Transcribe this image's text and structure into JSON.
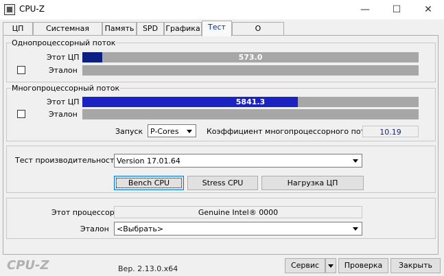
{
  "window": {
    "title": "CPU-Z",
    "minimize": "—",
    "maximize": "☐",
    "close": "✕"
  },
  "tabs": [
    {
      "label": "ЦП"
    },
    {
      "label": "Системная плата"
    },
    {
      "label": "Память"
    },
    {
      "label": "SPD"
    },
    {
      "label": "Графика"
    },
    {
      "label": "Тест"
    },
    {
      "label": "О программе"
    }
  ],
  "active_tab": "Тест",
  "single_thread": {
    "title": "Однопроцессорный поток",
    "this_cpu_label": "Этот ЦП",
    "this_cpu_value": "573.0",
    "this_cpu_fraction": 0.059,
    "reference_label": "Эталон",
    "bar_color": "#0a1f80"
  },
  "multi_thread": {
    "title": "Многопроцессорный поток",
    "this_cpu_label": "Этот ЦП",
    "this_cpu_value": "5841.3",
    "this_cpu_fraction": 0.641,
    "reference_label": "Эталон",
    "bar_color": "#1a23c2",
    "launch_label": "Запуск",
    "launch_value": "P-Cores",
    "ratio_label": "Коэффициент многопроцессорного потока",
    "ratio_value": "10.19"
  },
  "benchmark": {
    "label": "Тест производительности",
    "version_value": "Version 17.01.64",
    "bench_button": "Bench CPU",
    "stress_button": "Stress CPU",
    "load_button": "Нагрузка ЦП"
  },
  "processor": {
    "this_label": "Этот процессор",
    "this_value": "Genuine Intel® 0000",
    "reference_label": "Эталон",
    "reference_value": "<Выбрать>"
  },
  "footer": {
    "logo": "CPU-Z",
    "version": "Вер. 2.13.0.x64",
    "service_button": "Сервис",
    "validate_button": "Проверка",
    "close_button": "Закрыть"
  },
  "icons": {
    "app": "cpu-z-icon",
    "dropdown": "chevron-down-icon"
  }
}
